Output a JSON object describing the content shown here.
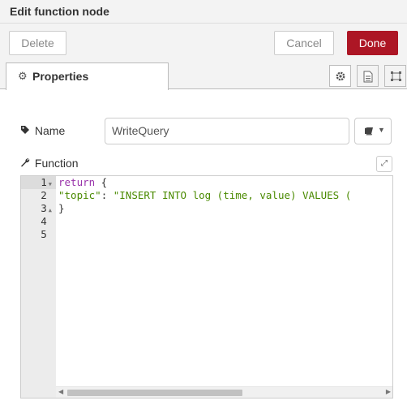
{
  "dialog": {
    "title": "Edit function node"
  },
  "buttons": {
    "delete": "Delete",
    "cancel": "Cancel",
    "done": "Done"
  },
  "tabs": {
    "properties": "Properties"
  },
  "form": {
    "name_label": "Name",
    "name_value": "WriteQuery",
    "function_label": "Function"
  },
  "editor": {
    "line_numbers": [
      "1",
      "2",
      "3",
      "4",
      "5"
    ],
    "line1_kw": "return",
    "line1_rest": " {",
    "line2_key": "\"topic\"",
    "line2_colon": ": ",
    "line2_value": "\"INSERT INTO log (time, value) VALUES (",
    "line3": "}"
  },
  "colors": {
    "done_button": "#ad1625",
    "keyword": "#9933aa",
    "string": "#4a8a00"
  }
}
